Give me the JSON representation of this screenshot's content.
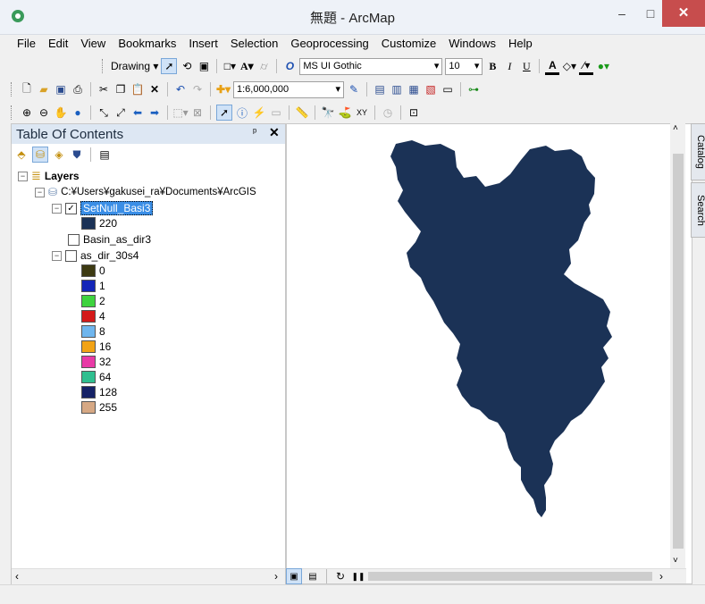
{
  "window": {
    "title": "無題 - ArcMap",
    "minimize": "–",
    "maximize": "□",
    "close": "✕"
  },
  "menu": [
    "File",
    "Edit",
    "View",
    "Bookmarks",
    "Insert",
    "Selection",
    "Geoprocessing",
    "Customize",
    "Windows",
    "Help"
  ],
  "draw_toolbar": {
    "drawing_label": "Drawing ▾",
    "font_name": "MS UI Gothic",
    "font_size": "10"
  },
  "standard_toolbar": {
    "scale": "1:6,000,000"
  },
  "toc": {
    "title": "Table Of Contents",
    "pin": "ᵖ",
    "close": "✕",
    "root_label": "Layers",
    "workspace_path": "C:¥Users¥gakusei_ra¥Documents¥ArcGIS",
    "layers": [
      {
        "name": "SetNull_Basi3",
        "checked": true,
        "selected": true,
        "legend": [
          {
            "label": "220",
            "color": "#1b3256"
          }
        ]
      },
      {
        "name": "Basin_as_dir3",
        "checked": false,
        "selected": false,
        "legend": []
      },
      {
        "name": "as_dir_30s4",
        "checked": false,
        "selected": false,
        "legend": [
          {
            "label": "0",
            "color": "#3d3a12"
          },
          {
            "label": "1",
            "color": "#1426b8"
          },
          {
            "label": "2",
            "color": "#3ed33e"
          },
          {
            "label": "4",
            "color": "#d41a1a"
          },
          {
            "label": "8",
            "color": "#6fb6ee"
          },
          {
            "label": "16",
            "color": "#f2a316"
          },
          {
            "label": "32",
            "color": "#e83aa6"
          },
          {
            "label": "64",
            "color": "#2fbf8f"
          },
          {
            "label": "128",
            "color": "#152266"
          },
          {
            "label": "255",
            "color": "#d6a884"
          }
        ]
      }
    ]
  },
  "side_tabs": [
    "Catalog",
    "Search"
  ],
  "map": {
    "basin_color": "#1b3256"
  }
}
